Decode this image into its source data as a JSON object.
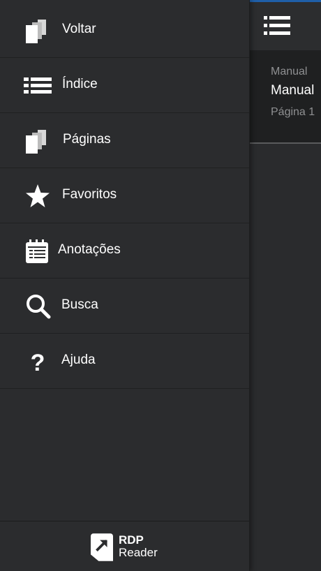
{
  "menu": {
    "items": [
      {
        "label": "Voltar",
        "icon": "pages-back-icon"
      },
      {
        "label": "Índice",
        "icon": "list-icon"
      },
      {
        "label": "Páginas",
        "icon": "pages-icon"
      },
      {
        "label": "Favoritos",
        "icon": "star-icon"
      },
      {
        "label": "Anotações",
        "icon": "notes-icon"
      },
      {
        "label": "Busca",
        "icon": "search-icon"
      },
      {
        "label": "Ajuda",
        "icon": "help-icon"
      }
    ]
  },
  "footer": {
    "logo_line1": "RDP",
    "logo_line2": "Reader"
  },
  "content": {
    "doc_line1": "Manual",
    "doc_line2": "Manual",
    "doc_line3": "Página 1"
  },
  "colors": {
    "background": "#272829",
    "menu_bg": "#2b2c2e",
    "accent": "#1f5fa8",
    "muted_text": "#8f9092"
  }
}
